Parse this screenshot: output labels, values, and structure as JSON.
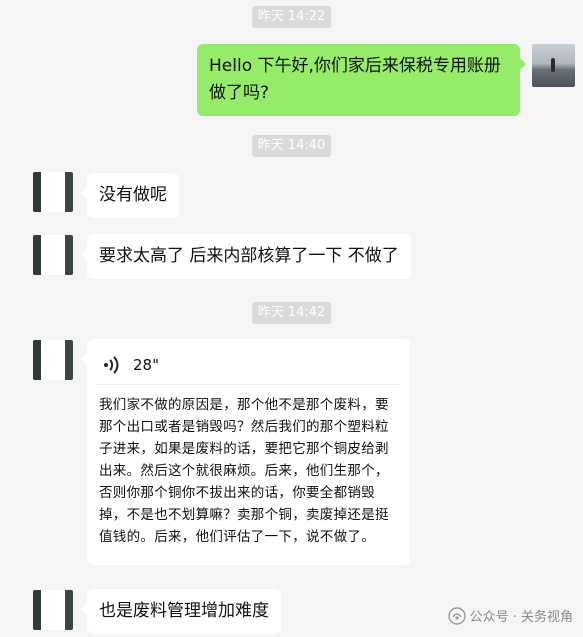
{
  "messages": {
    "ts1": "昨天 14:22",
    "msg1": "Hello 下午好,你们家后来保税专用账册做了吗?",
    "ts2": "昨天 14:40",
    "msg2": "没有做呢",
    "msg3": "要求太高了 后来内部核算了一下 不做了",
    "ts3": "昨天 14:42",
    "voice": {
      "duration": "28\"",
      "transcript": "我们家不做的原因是，那个他不是那个废料，要那个出口或者是销毁吗？然后我们的那个塑料粒子进来，如果是废料的话，要把它那个铜皮给剥出来。然后这个就很麻烦。后来，他们生那个，否则你那个铜你不拔出来的话，你要全都销毁掉，不是也不划算嘛？卖那个铜，卖废掉还是挺值钱的。后来，他们评估了一下，说不做了。"
    },
    "msg4": "也是废料管理增加难度"
  },
  "watermark": {
    "text": "公众号 · 关务视角"
  },
  "colors": {
    "background": "#f5f5f5",
    "sent_bubble": "#95ec69",
    "received_bubble": "#ffffff",
    "timestamp_bg": "#dadada"
  }
}
